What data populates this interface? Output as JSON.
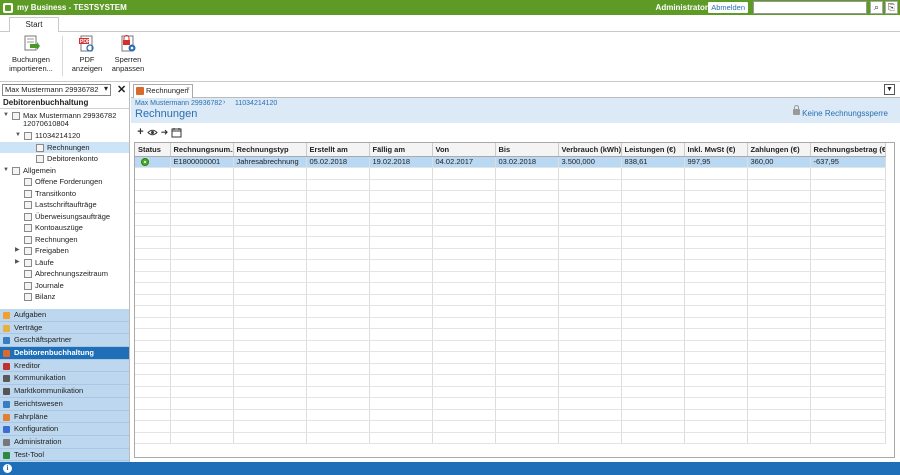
{
  "app": {
    "title": "my Business - TESTSYSTEM",
    "user": "Administrator",
    "logout_label": "Abmelden",
    "search_value": ""
  },
  "ribbon": {
    "tab": "Start",
    "buttons": [
      {
        "line1": "Buchungen",
        "line2": "importieren...",
        "icon": "import-icon"
      },
      {
        "line1": "PDF",
        "line2": "anzeigen",
        "icon": "pdf-icon"
      },
      {
        "line1": "Sperren",
        "line2": "anpassen",
        "icon": "lock-settings-icon"
      }
    ]
  },
  "left": {
    "context": "Max Mustermann 29936782",
    "heading": "Debitorenbuchhaltung",
    "tree": [
      {
        "label": "Max Mustermann 29936782",
        "label2": "12070610804",
        "level": 0,
        "exp": "▼"
      },
      {
        "label": "11034214120",
        "level": 1,
        "exp": "▼"
      },
      {
        "label": "Rechnungen",
        "level": 2,
        "selected": true
      },
      {
        "label": "Debitorenkonto",
        "level": 2
      },
      {
        "label": "Allgemein",
        "level": 0,
        "exp": "▼"
      },
      {
        "label": "Offene Forderungen",
        "level": 1
      },
      {
        "label": "Transitkonto",
        "level": 1
      },
      {
        "label": "Lastschriftaufträge",
        "level": 1
      },
      {
        "label": "Überweisungsaufträge",
        "level": 1
      },
      {
        "label": "Kontoauszüge",
        "level": 1
      },
      {
        "label": "Rechnungen",
        "level": 1
      },
      {
        "label": "Freigaben",
        "level": 1,
        "exp": "▶"
      },
      {
        "label": "Läufe",
        "level": 1,
        "exp": "▶"
      },
      {
        "label": "Abrechnungszeitraum",
        "level": 1
      },
      {
        "label": "Journale",
        "level": 1
      },
      {
        "label": "Bilanz",
        "level": 1
      }
    ],
    "nav": [
      {
        "label": "Aufgaben",
        "color": "#f0a030"
      },
      {
        "label": "Verträge",
        "color": "#e8b040"
      },
      {
        "label": "Geschäftspartner",
        "color": "#3a7cc0"
      },
      {
        "label": "Debitorenbuchhaltung",
        "color": "#d96a2b",
        "active": true
      },
      {
        "label": "Kreditor",
        "color": "#c03030"
      },
      {
        "label": "Kommunikation",
        "color": "#5a5a5a"
      },
      {
        "label": "Marktkommunikation",
        "color": "#555555"
      },
      {
        "label": "Berichtswesen",
        "color": "#3a7cc0"
      },
      {
        "label": "Fahrpläne",
        "color": "#e08030"
      },
      {
        "label": "Konfiguration",
        "color": "#3a6fd0"
      },
      {
        "label": "Administration",
        "color": "#777777"
      },
      {
        "label": "Test-Tool",
        "color": "#2e8a40"
      }
    ]
  },
  "main": {
    "tab_label": "Rechnungen",
    "breadcrumb": [
      "Max Mustermann 29936782",
      "11034214120"
    ],
    "page_title": "Rechnungen",
    "lock_link": "Keine Rechnungssperre",
    "columns": [
      "Status",
      "Rechnungsnum...",
      "Rechnungstyp",
      "Erstellt am",
      "Fällig am",
      "Von",
      "Bis",
      "Verbrauch (kWh)",
      "Leistungen (€)",
      "Inkl. MwSt (€)",
      "Zahlungen (€)",
      "Rechnungsbetrag (€)"
    ],
    "rows": [
      [
        "",
        "E1800000001",
        "Jahresabrechnung",
        "05.02.2018",
        "19.02.2018",
        "04.02.2017",
        "03.02.2018",
        "3.500,000",
        "838,61",
        "997,95",
        "360,00",
        "-637,95"
      ]
    ],
    "empty_rows": 24
  },
  "colors": {
    "titlebar": "#5e9a26",
    "selection": "#b8d8f3",
    "nav_bg": "#bcd7ee",
    "accent": "#1e6fb8"
  }
}
